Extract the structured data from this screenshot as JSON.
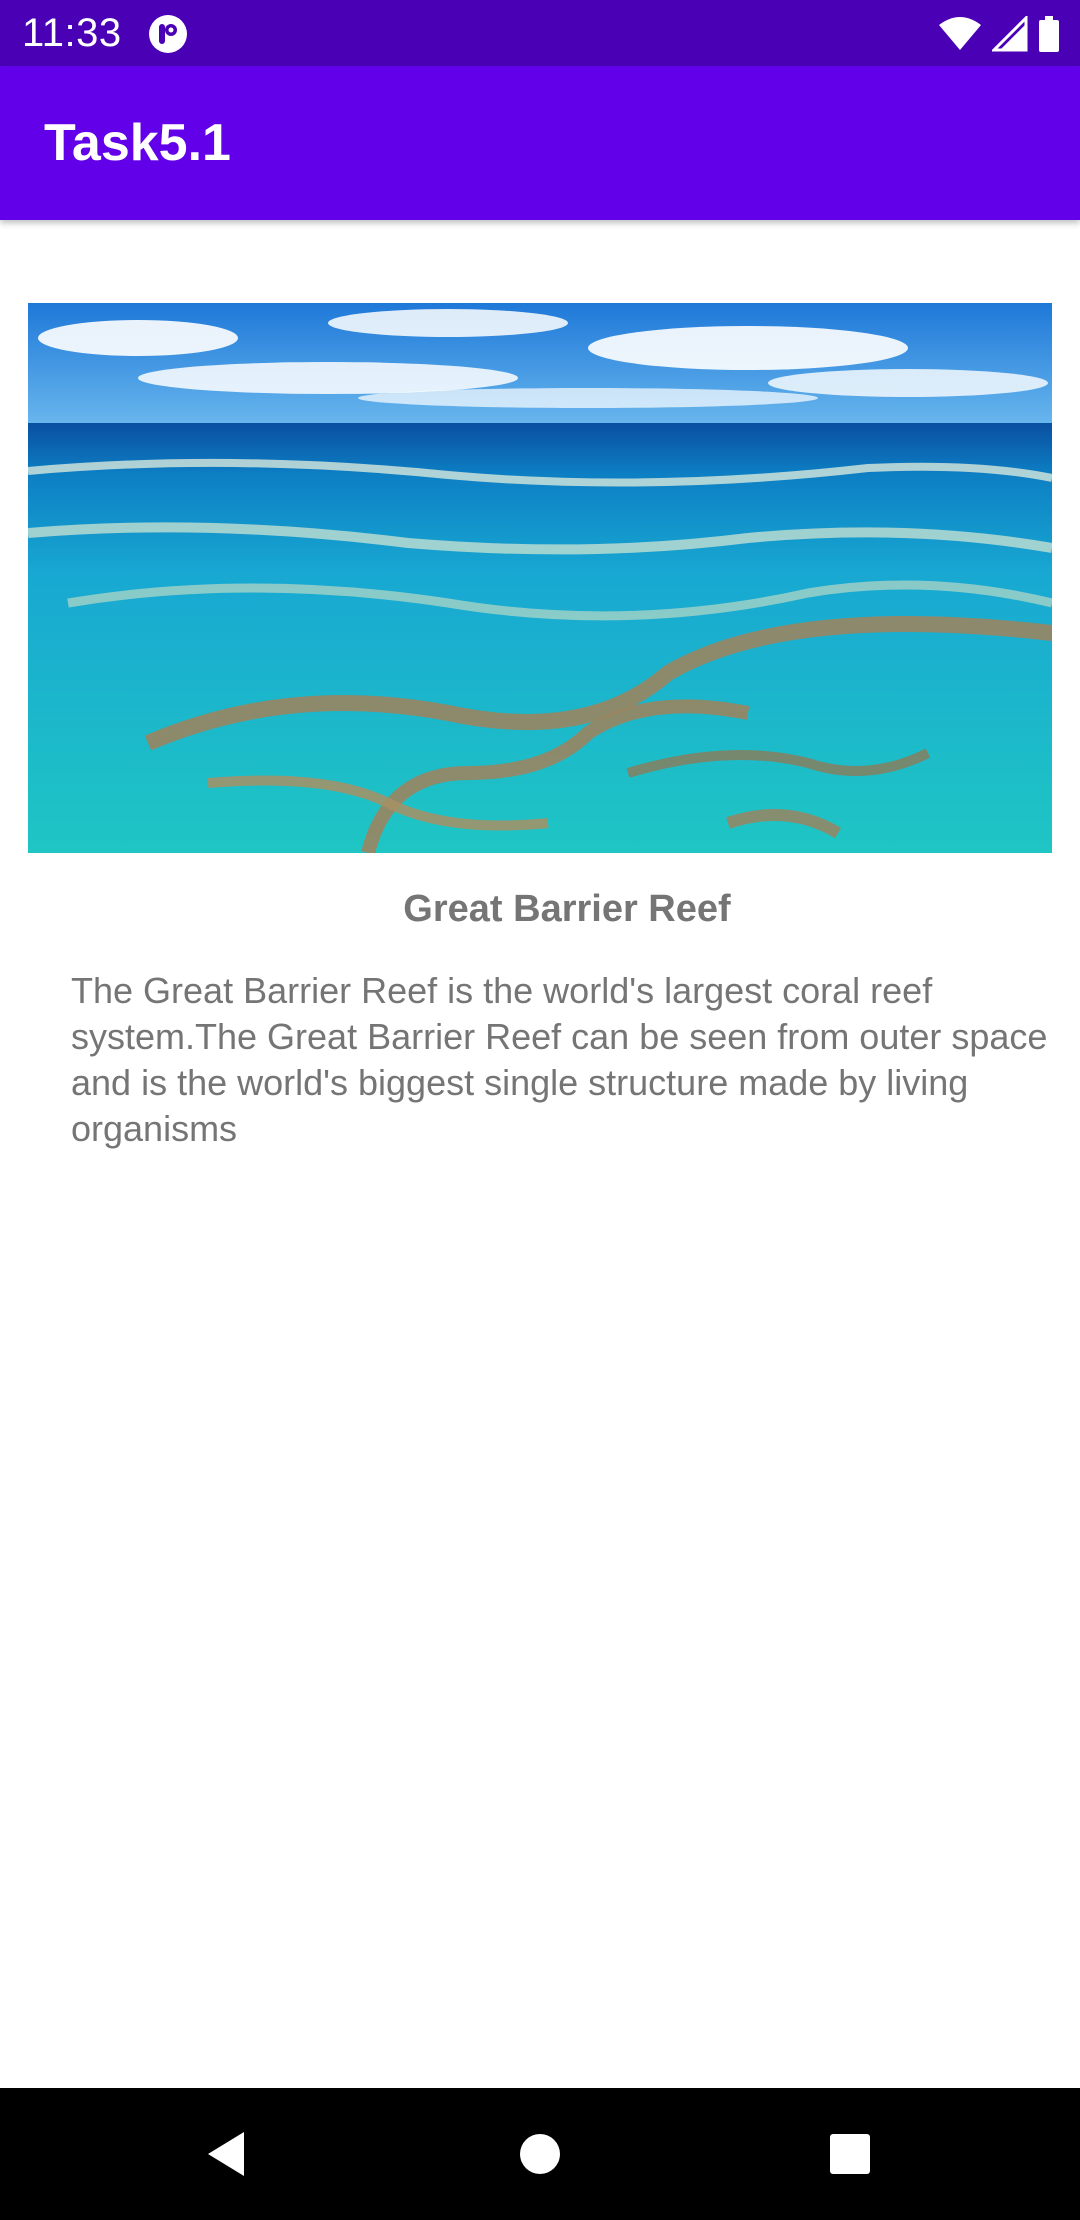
{
  "status_bar": {
    "time": "11:33",
    "icons": [
      "app-notification-icon",
      "wifi-icon",
      "cell-signal-icon",
      "battery-icon"
    ]
  },
  "app_bar": {
    "title": "Task5.1"
  },
  "content": {
    "image_alt": "Great Barrier Reef aerial view",
    "title": "Great Barrier Reef",
    "description": "The Great Barrier Reef is the world's largest coral reef system.The Great Barrier Reef can be seen from outer space and is the world's biggest single structure made by living organisms"
  },
  "nav_bar": {
    "icons": [
      "back-icon",
      "home-icon",
      "recents-icon"
    ]
  },
  "colors": {
    "status_bar": "#4a00b5",
    "app_bar": "#6200ea",
    "text_gray": "#757575",
    "nav_bar": "#000000"
  }
}
